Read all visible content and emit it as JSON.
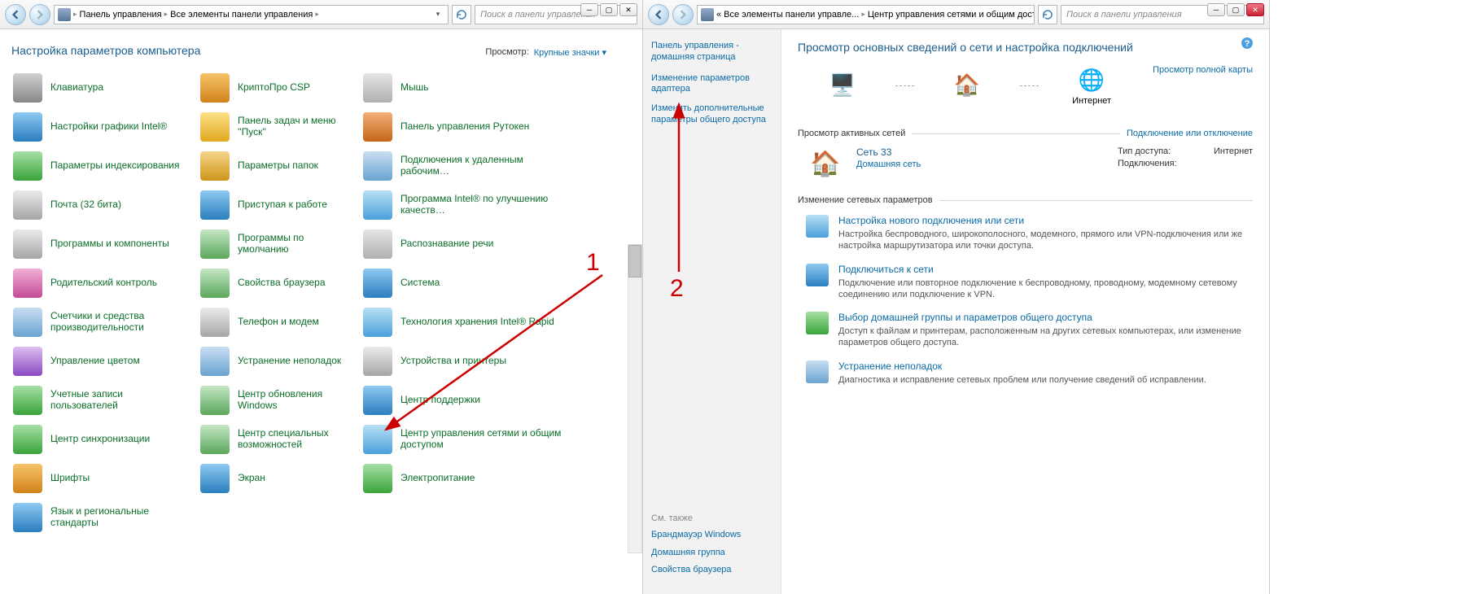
{
  "win1": {
    "breadcrumb": [
      "Панель управления",
      "Все элементы панели управления"
    ],
    "search_ph": "Поиск в панели управления",
    "title": "Настройка параметров компьютера",
    "view_lbl": "Просмотр:",
    "view_val": "Крупные значки",
    "items": [
      {
        "label": "Клавиатура",
        "ic": "ic-a"
      },
      {
        "label": "КриптоПро CSP",
        "ic": "ic-b"
      },
      {
        "label": "Мышь",
        "ic": "ic-c"
      },
      {
        "label": "Настройки графики Intel®",
        "ic": "ic-d"
      },
      {
        "label": "Панель задач и меню ''Пуск''",
        "ic": "ic-e"
      },
      {
        "label": "Панель управления Рутокен",
        "ic": "ic-f"
      },
      {
        "label": "Параметры индексирования",
        "ic": "ic-g"
      },
      {
        "label": "Параметры папок",
        "ic": "ic-m"
      },
      {
        "label": "Подключения к удаленным рабочим…",
        "ic": "ic-i"
      },
      {
        "label": "Почта (32 бита)",
        "ic": "ic-j"
      },
      {
        "label": "Приступая к работе",
        "ic": "ic-d"
      },
      {
        "label": "Программа Intel® по улучшению качеств…",
        "ic": "ic-n"
      },
      {
        "label": "Программы и компоненты",
        "ic": "ic-j"
      },
      {
        "label": "Программы по умолчанию",
        "ic": "ic-k"
      },
      {
        "label": "Распознавание речи",
        "ic": "ic-c"
      },
      {
        "label": "Родительский контроль",
        "ic": "ic-h"
      },
      {
        "label": "Свойства браузера",
        "ic": "ic-k"
      },
      {
        "label": "Система",
        "ic": "ic-d"
      },
      {
        "label": "Счетчики и средства производительности",
        "ic": "ic-i"
      },
      {
        "label": "Телефон и модем",
        "ic": "ic-j"
      },
      {
        "label": "Технология хранения Intel® Rapid",
        "ic": "ic-n"
      },
      {
        "label": "Управление цветом",
        "ic": "ic-l"
      },
      {
        "label": "Устранение неполадок",
        "ic": "ic-i"
      },
      {
        "label": "Устройства и принтеры",
        "ic": "ic-j"
      },
      {
        "label": "Учетные записи пользователей",
        "ic": "ic-g"
      },
      {
        "label": "Центр обновления Windows",
        "ic": "ic-k"
      },
      {
        "label": "Центр поддержки",
        "ic": "ic-d"
      },
      {
        "label": "Центр синхронизации",
        "ic": "ic-g"
      },
      {
        "label": "Центр специальных возможностей",
        "ic": "ic-k"
      },
      {
        "label": "Центр управления сетями и общим доступом",
        "ic": "ic-n"
      },
      {
        "label": "Шрифты",
        "ic": "ic-b"
      },
      {
        "label": "Экран",
        "ic": "ic-d"
      },
      {
        "label": "Электропитание",
        "ic": "ic-g"
      },
      {
        "label": "Язык и региональные стандарты",
        "ic": "ic-d"
      }
    ]
  },
  "win2": {
    "breadcrumb_prefix": "«",
    "breadcrumb": [
      "Все элементы панели управле...",
      "Центр управления сетями и общим доступом"
    ],
    "search_ph": "Поиск в панели управления",
    "side": {
      "home": "Панель управления - домашняя страница",
      "links": [
        "Изменение параметров адаптера",
        "Изменить дополнительные параметры общего доступа"
      ],
      "see_also_hdr": "См. также",
      "see_also": [
        "Брандмауэр Windows",
        "Домашняя группа",
        "Свойства браузера"
      ]
    },
    "main_title": "Просмотр основных сведений о сети и настройка подключений",
    "full_map": "Просмотр полной карты",
    "map_nodes": [
      "",
      "",
      "Интернет"
    ],
    "active_hdr": "Просмотр активных сетей",
    "connect_link": "Подключение или отключение",
    "network": {
      "name": "Сеть  33",
      "type": "Домашняя сеть",
      "props": [
        {
          "k": "Тип доступа:",
          "v": "Интернет"
        },
        {
          "k": "Подключения:",
          "v": ""
        }
      ]
    },
    "change_hdr": "Изменение сетевых параметров",
    "tasks": [
      {
        "title": "Настройка нового подключения или сети",
        "desc": "Настройка беспроводного, широкополосного, модемного, прямого или VPN-подключения или же настройка маршрутизатора или точки доступа."
      },
      {
        "title": "Подключиться к сети",
        "desc": "Подключение или повторное подключение к беспроводному, проводному, модемному сетевому соединению или подключение к VPN."
      },
      {
        "title": "Выбор домашней группы и параметров общего доступа",
        "desc": "Доступ к файлам и принтерам, расположенным на других сетевых компьютерах, или изменение параметров общего доступа."
      },
      {
        "title": "Устранение неполадок",
        "desc": "Диагностика и исправление сетевых проблем или получение сведений об исправлении."
      }
    ]
  },
  "annotations": {
    "n1": "1",
    "n2": "2"
  }
}
